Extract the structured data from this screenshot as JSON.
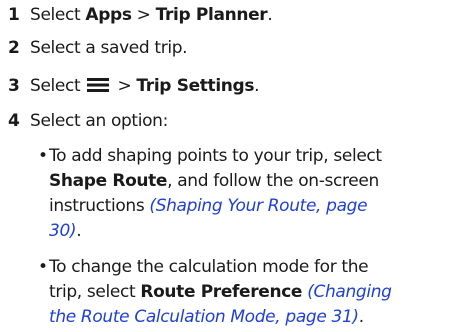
{
  "steps": [
    {
      "number": "1",
      "text1": "Select ",
      "bold1": "Apps",
      "sep": " > ",
      "bold2": "Trip Planner",
      "end": "."
    },
    {
      "number": "2",
      "text1": "Select a saved trip."
    },
    {
      "number": "3",
      "text1": "Select ",
      "icon": "menu-icon",
      "sep": " > ",
      "bold2": "Trip Settings",
      "end": "."
    },
    {
      "number": "4",
      "text1": "Select an option:"
    }
  ],
  "bullets": [
    {
      "line1": "To add shaping points to your trip, select",
      "bold": "Shape Route",
      "line2_rest": ", and follow the on-screen",
      "line3_text": "instructions ",
      "link_part1": "(Shaping Your Route, page",
      "link_part2": "30)",
      "end": "."
    },
    {
      "line1": "To change the calculation mode for the",
      "line2_text": "trip, select ",
      "bold": "Route Preference",
      "link_part1": "(Changing",
      "link_part2": "the Route Calculation Mode, page 31)",
      "end": "."
    }
  ],
  "colors": {
    "link": "#1e3fd6",
    "text": "#1a1a1a"
  }
}
